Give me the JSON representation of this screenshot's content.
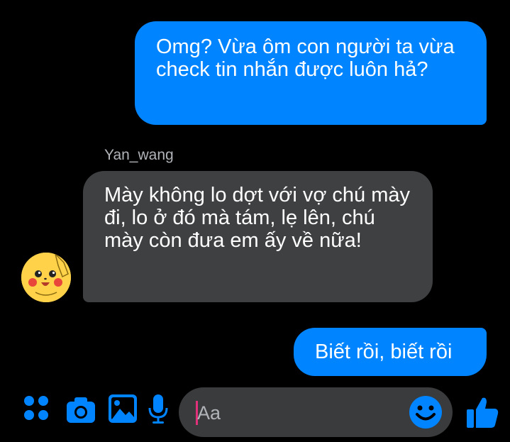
{
  "messages": [
    {
      "direction": "outgoing",
      "text": "Omg? Vừa ôm con người ta vừa check tin nhắn được luôn hả?"
    },
    {
      "direction": "incoming",
      "text": "Mày không lo dợt với vợ chú mày đi, lo ở đó mà tám, lẹ lên, chú mày còn đưa em ấy về nữa!"
    },
    {
      "direction": "outgoing",
      "text": "Biết rồi, biết rồi"
    }
  ],
  "sender_name": "Yan_wang",
  "composer": {
    "placeholder": "Aa"
  },
  "icons": {
    "toolbar": [
      "apps-icon",
      "camera-icon",
      "image-icon",
      "microphone-icon"
    ],
    "emoji": "emoji-icon",
    "like": "thumbs-up-icon"
  },
  "colors": {
    "accent": "#0084ff",
    "incoming_bubble": "#3e4042",
    "background": "#000000",
    "composer_bg": "#3a3b3c"
  }
}
